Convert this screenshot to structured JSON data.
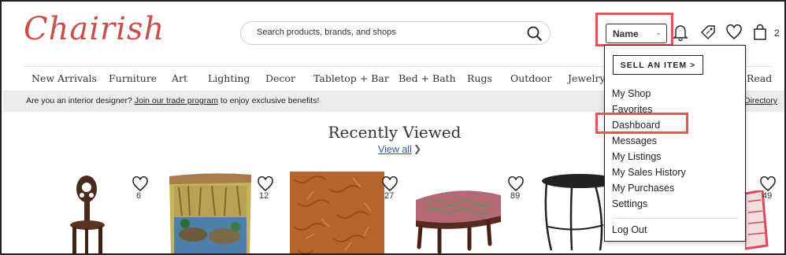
{
  "brand": {
    "logo_text": "Chairish"
  },
  "search": {
    "placeholder": "Search products, brands, and shops"
  },
  "header": {
    "user_name": "Name",
    "cart_count": "2"
  },
  "nav": [
    "New Arrivals",
    "Furniture",
    "Art",
    "Lighting",
    "Decor",
    "Tabletop + Bar",
    "Bed + Bath",
    "Rugs",
    "Outdoor",
    "Jewelry",
    "Read"
  ],
  "promo": {
    "before": "Are you an interior designer? ",
    "link": "Join our trade program",
    "after": " to enjoy exclusive benefits!",
    "right_link": "Directory"
  },
  "recent": {
    "title": "Recently Viewed",
    "view_all": "View all",
    "products": [
      {
        "favorites": "6"
      },
      {
        "favorites": "12"
      },
      {
        "favorites": "27"
      },
      {
        "favorites": "89"
      },
      {
        "favorites": ""
      },
      {
        "favorites": "49"
      }
    ]
  },
  "dropdown": {
    "sell_label": "SELL AN ITEM >",
    "items": [
      "My Shop",
      "Favorites",
      "Dashboard",
      "Messages",
      "My Listings",
      "My Sales History",
      "My Purchases",
      "Settings"
    ],
    "logout": "Log Out"
  },
  "colors": {
    "brand": "#c8504a",
    "highlight": "#e05555",
    "link": "#2a5bb5",
    "promo_bg": "#ececec"
  },
  "icons": [
    "search-icon",
    "chevron-down-icon",
    "bell-icon",
    "tag-icon",
    "heart-icon",
    "shopping-bag-icon",
    "chevron-right-icon"
  ]
}
